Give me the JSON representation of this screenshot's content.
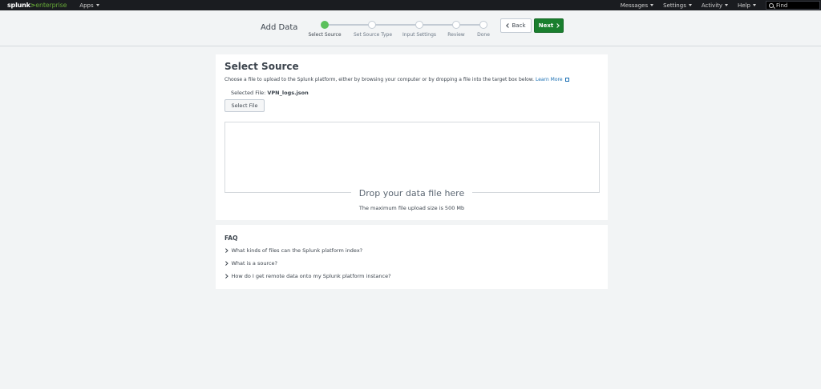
{
  "topnav": {
    "logo_main": "splunk",
    "logo_gt": ">",
    "logo_ent": "enterprise",
    "apps_label": "Apps",
    "messages_label": "Messages",
    "settings_label": "Settings",
    "activity_label": "Activity",
    "help_label": "Help",
    "find_placeholder": "Find"
  },
  "wizard": {
    "title": "Add Data",
    "steps": [
      {
        "label": "Select Source",
        "active": true
      },
      {
        "label": "Set Source Type",
        "active": false
      },
      {
        "label": "Input Settings",
        "active": false
      },
      {
        "label": "Review",
        "active": false
      },
      {
        "label": "Done",
        "active": false
      }
    ],
    "back_label": "Back",
    "next_label": "Next",
    "active_color": "#5cc05c",
    "next_color": "#1a7f2e"
  },
  "source": {
    "title": "Select Source",
    "description": "Choose a file to upload to the Splunk platform, either by browsing your computer or by dropping a file into the target box below.",
    "learn_more": "Learn More",
    "selected_label": "Selected File:",
    "selected_file": "VPN_logs.json",
    "select_button": "Select File",
    "drop_text": "Drop your data file here",
    "max_size_text": "The maximum file upload size is 500 Mb"
  },
  "faq": {
    "title": "FAQ",
    "items": [
      "What kinds of files can the Splunk platform index?",
      "What is a source?",
      "How do I get remote data onto my Splunk platform instance?"
    ]
  }
}
